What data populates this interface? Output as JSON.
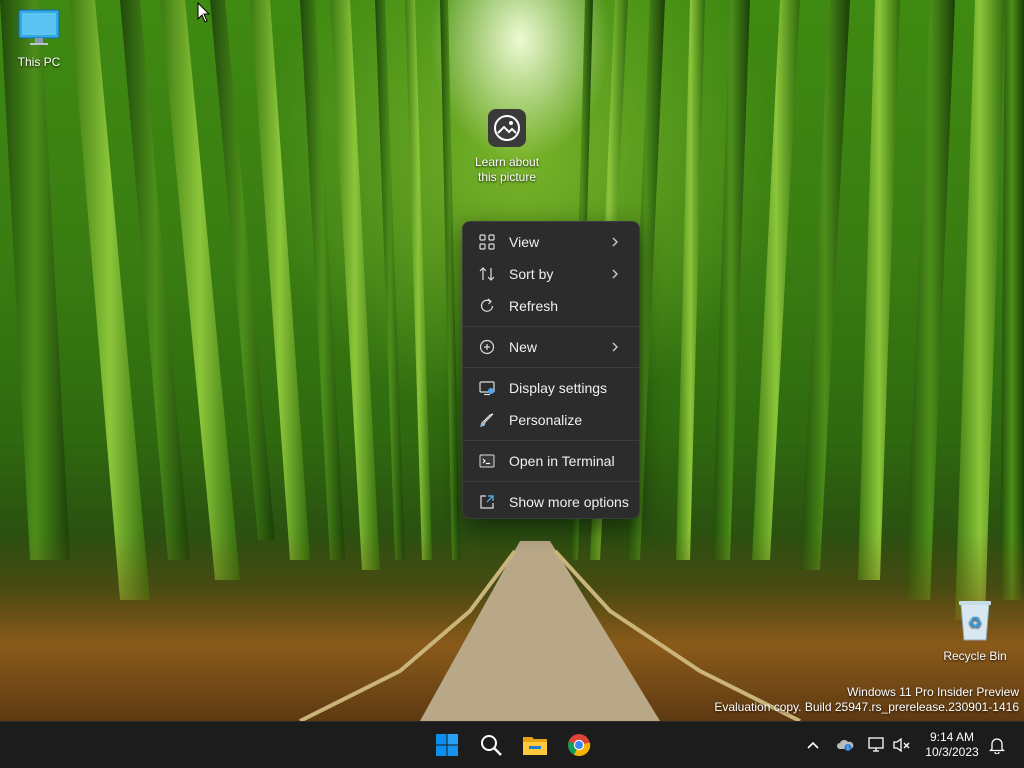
{
  "desktop": {
    "icons": [
      {
        "label": "This PC"
      },
      {
        "label": "Learn about this picture"
      },
      {
        "label": "Recycle Bin"
      }
    ]
  },
  "context_menu": {
    "items": [
      {
        "label": "View",
        "icon": "grid-icon",
        "has_submenu": true
      },
      {
        "label": "Sort by",
        "icon": "sort-icon",
        "has_submenu": true
      },
      {
        "label": "Refresh",
        "icon": "refresh-icon",
        "has_submenu": false
      },
      {
        "label": "New",
        "icon": "plus-circle-icon",
        "has_submenu": true
      },
      {
        "label": "Display settings",
        "icon": "display-icon",
        "has_submenu": false
      },
      {
        "label": "Personalize",
        "icon": "brush-icon",
        "has_submenu": false
      },
      {
        "label": "Open in Terminal",
        "icon": "terminal-icon",
        "has_submenu": false
      },
      {
        "label": "Show more options",
        "icon": "external-icon",
        "has_submenu": false
      }
    ]
  },
  "watermark": {
    "line1": "Windows 11 Pro Insider Preview",
    "line2": "Evaluation copy. Build 25947.rs_prerelease.230901-1416"
  },
  "taskbar": {
    "pinned": [
      "start-icon",
      "search-icon",
      "file-explorer-icon",
      "chrome-icon"
    ],
    "tray": [
      "chevron-up-icon",
      "onedrive-icon",
      "network-icon",
      "volume-muted-icon"
    ],
    "clock": {
      "time": "9:14 AM",
      "date": "10/3/2023"
    }
  },
  "colors": {
    "menu_bg": "#2c2c2c",
    "taskbar_bg": "#1c1c1c",
    "start_blue": "#0a8ff0"
  }
}
